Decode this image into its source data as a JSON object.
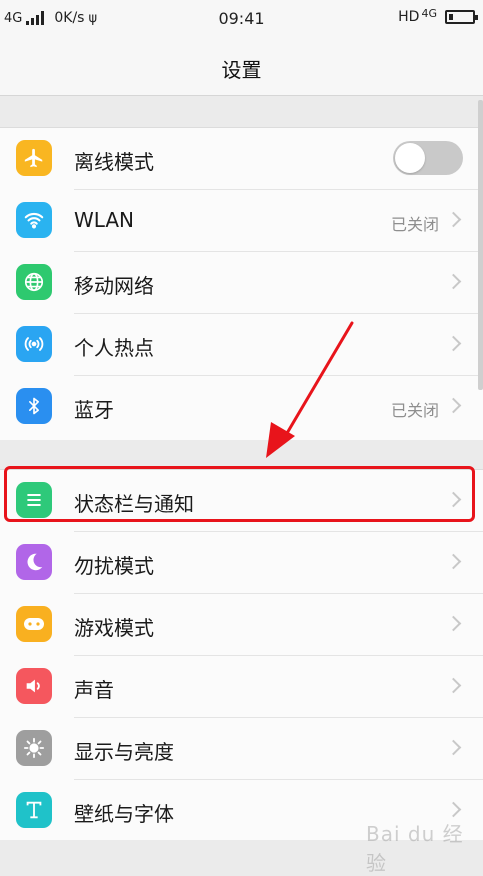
{
  "status_bar": {
    "network_left": "4G",
    "speed": "0K/s",
    "time": "09:41",
    "hd": "HD",
    "network_right": "4G"
  },
  "header": {
    "title": "设置"
  },
  "groups": [
    {
      "items": [
        {
          "label": "离线模式",
          "icon": "airplane-icon",
          "color": "#f9b621"
        },
        {
          "label": "WLAN",
          "value": "已关闭",
          "icon": "wifi-icon",
          "color": "#2ab3f0"
        },
        {
          "label": "移动网络",
          "icon": "globe-icon",
          "color": "#2ec96f"
        },
        {
          "label": "个人热点",
          "icon": "hotspot-icon",
          "color": "#2aa5f2"
        },
        {
          "label": "蓝牙",
          "value": "已关闭",
          "icon": "bluetooth-icon",
          "color": "#2a8ff0"
        }
      ]
    },
    {
      "items": [
        {
          "label": "状态栏与通知",
          "icon": "notification-list-icon",
          "color": "#2ec97a"
        },
        {
          "label": "勿扰模式",
          "icon": "moon-icon",
          "color": "#b166e8"
        },
        {
          "label": "游戏模式",
          "icon": "gamepad-icon",
          "color": "#f9b020"
        },
        {
          "label": "声音",
          "icon": "speaker-icon",
          "color": "#f5575e"
        },
        {
          "label": "显示与亮度",
          "icon": "brightness-icon",
          "color": "#9e9e9e"
        },
        {
          "label": "壁纸与字体",
          "icon": "font-t-icon",
          "color": "#1fc2c9"
        }
      ]
    }
  ],
  "airplane_toggle": {
    "on": false
  },
  "watermark": "Bai du 经验",
  "accent_colors": {
    "annotation_red": "#e8141b"
  }
}
